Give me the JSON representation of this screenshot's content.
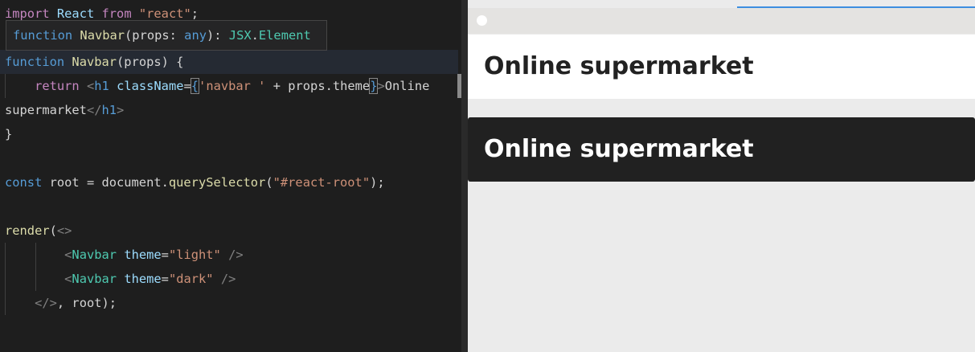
{
  "editor": {
    "lines": {
      "l1": {
        "kw": "import",
        "name": "React",
        "from": "from",
        "str": "\"react\"",
        "end": ";"
      },
      "l3": {
        "kw": "function",
        "name": "Navbar",
        "rest": "(props) {"
      },
      "l4": {
        "ret": "return",
        "open": "<",
        "tag": "h1",
        "attr": "className",
        "eq": "=",
        "lb": "{",
        "str": "'navbar '",
        "mid": " + props.theme",
        "rb": "}",
        "gt": ">",
        "text": "Online"
      },
      "l5": {
        "text": "supermarket",
        "close1": "</",
        "tag": "h1",
        "close2": ">"
      },
      "l6": {
        "brace": "}"
      },
      "l8": {
        "kw": "const",
        "mid": " root = document.",
        "fn": "querySelector",
        "lp": "(",
        "str": "\"#react-root\"",
        "rp": ");"
      },
      "l10": {
        "fn": "render",
        "lp": "(",
        "frag": "<>"
      },
      "l11": {
        "open": "<",
        "tag": "Navbar",
        "attr": "theme",
        "eq": "=",
        "str": "\"light\"",
        "close": "/>"
      },
      "l12": {
        "open": "<",
        "tag": "Navbar",
        "attr": "theme",
        "eq": "=",
        "str": "\"dark\"",
        "close": "/>"
      },
      "l13": {
        "frag": "</>",
        "rest": ", root);"
      }
    },
    "tooltip": {
      "kw": "function",
      "name": "Navbar",
      "sig1": "(props: ",
      "any": "any",
      "sig2": "): ",
      "jsx": "JSX",
      "dot": ".",
      "elem": "Element"
    }
  },
  "preview": {
    "navbar_light": "Online supermarket",
    "navbar_dark": "Online supermarket"
  }
}
